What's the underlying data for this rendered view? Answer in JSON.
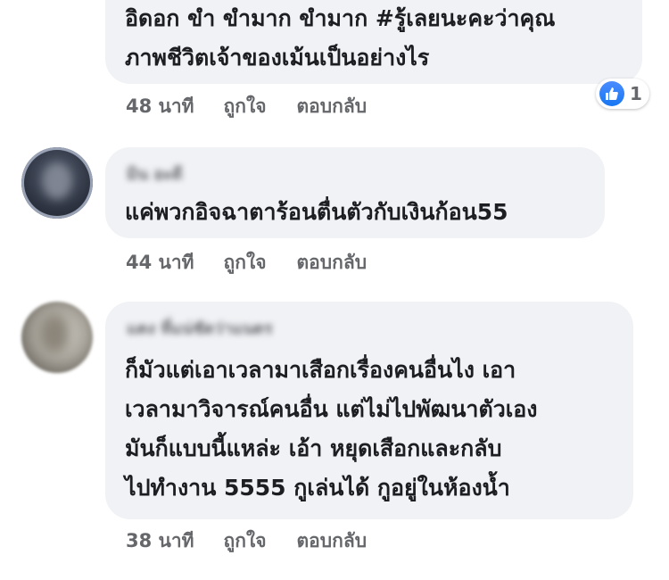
{
  "comments": [
    {
      "author": "",
      "lines": [
        "อิดอก ขำ ขำมาก ขำมาก #รู้เลยนะคะว่าคุณ",
        "ภาพชีวิตเจ้าของเม้นเป็นอย่างไร"
      ],
      "time": "48 นาที",
      "like_label": "ถูกใจ",
      "reply_label": "ตอบกลับ",
      "reactions": {
        "icon": "like-icon",
        "count": "1"
      }
    },
    {
      "author": "มิน อะดี",
      "lines": [
        "แค่พวกอิจฉาตาร้อนตื่นตัวกับเงินก้อน55"
      ],
      "time": "44 นาที",
      "like_label": "ถูกใจ",
      "reply_label": "ตอบกลับ"
    },
    {
      "author": "แตง ที่แน่ชัดว่าแนตร",
      "lines": [
        "ก็มัวแต่เอาเวลามาเสือกเรื่องคนอื่นไง เอา",
        "เวลามาวิจารณ์คนอื่น แต่ไม่ไปพัฒนาตัวเอง",
        "มันก็แบบนี้แหล่ะ เอ้า หยุดเสือกและกลับ",
        "ไปทำงาน 5555 กูเล่นได้ กูอยู่ในห้องน้ำ"
      ],
      "time": "38 นาที",
      "like_label": "ถูกใจ",
      "reply_label": "ตอบกลับ"
    }
  ],
  "colors": {
    "bubble": "#f0f2f5",
    "text": "#1c1e21",
    "meta": "#65676b",
    "like_blue": "#1877f2"
  }
}
